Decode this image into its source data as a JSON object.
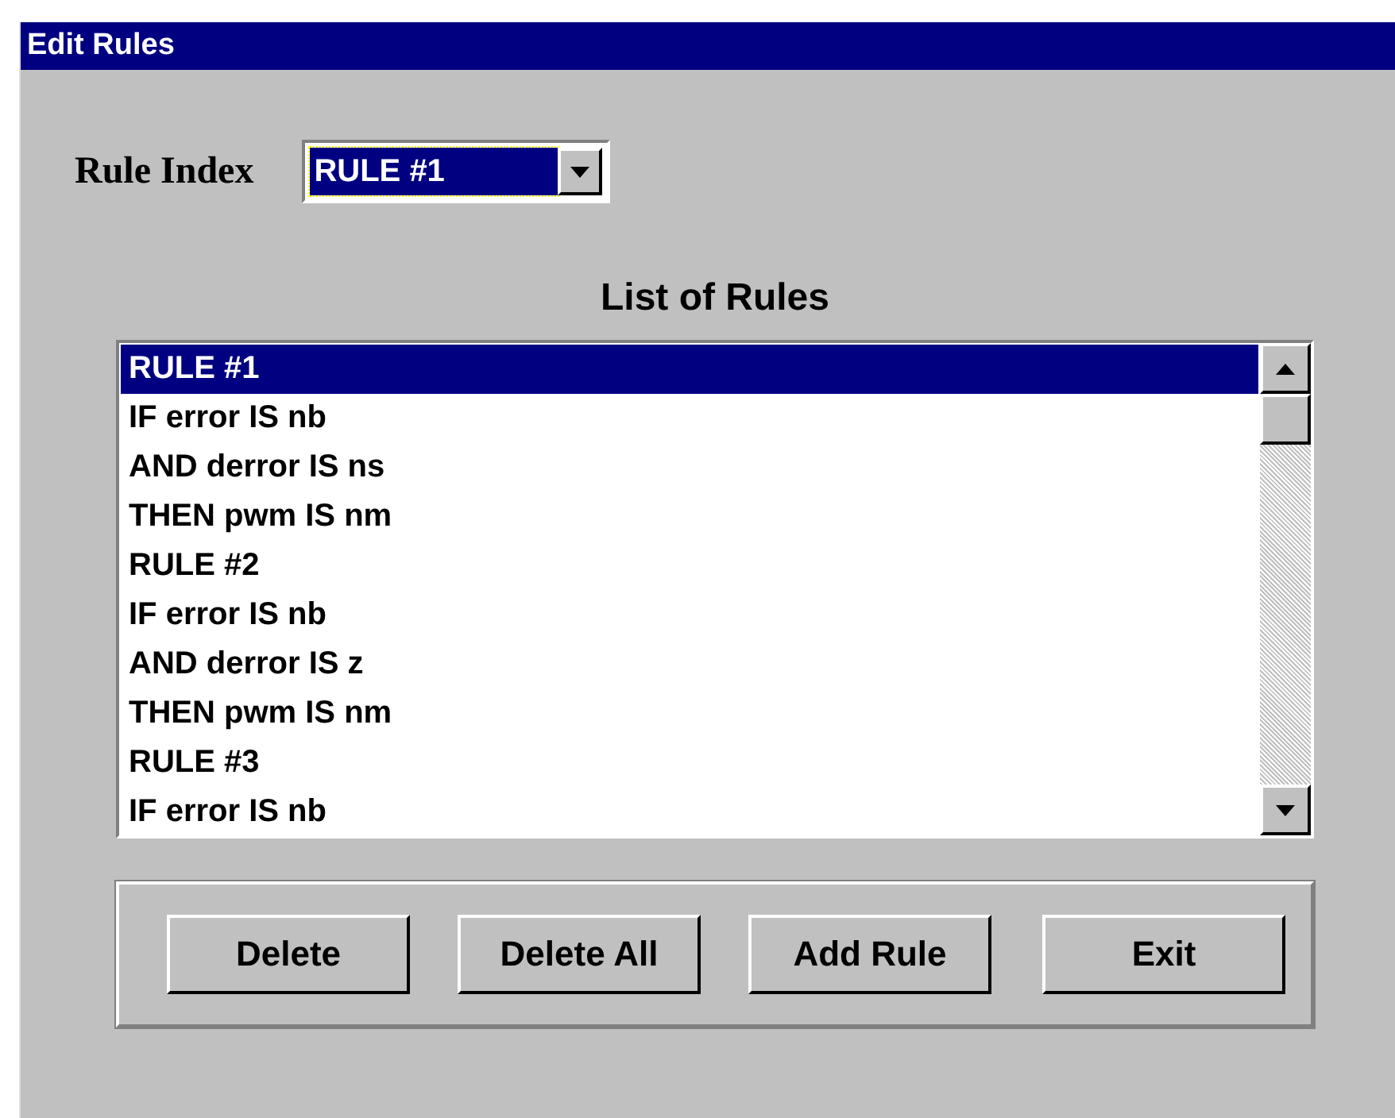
{
  "window": {
    "title": "Edit Rules"
  },
  "rule_index": {
    "label": "Rule Index",
    "value": "RULE #1"
  },
  "list": {
    "heading": "List of Rules",
    "items": [
      {
        "text": "RULE #1",
        "selected": true
      },
      {
        "text": "IF error IS nb",
        "selected": false
      },
      {
        "text": "AND derror IS ns",
        "selected": false
      },
      {
        "text": "THEN pwm IS nm",
        "selected": false
      },
      {
        "text": "RULE #2",
        "selected": false
      },
      {
        "text": "IF error IS nb",
        "selected": false
      },
      {
        "text": "AND derror IS z",
        "selected": false
      },
      {
        "text": "THEN pwm IS nm",
        "selected": false
      },
      {
        "text": "RULE #3",
        "selected": false
      },
      {
        "text": "IF error IS nb",
        "selected": false
      }
    ]
  },
  "buttons": [
    "Delete",
    "Delete All",
    "Add Rule",
    "Exit"
  ]
}
